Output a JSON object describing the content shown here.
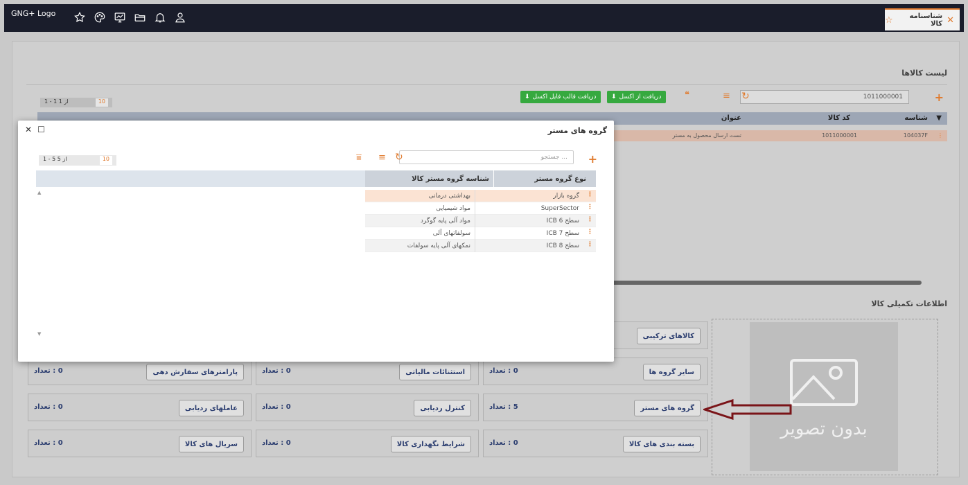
{
  "topbar": {
    "logo_text": "GNG+ Logo",
    "tab_label": "شناسنامه کالا"
  },
  "main": {
    "list_title": "لیست کالاها",
    "search_value": "1011000001",
    "btn_template": "دریافت قالب فایل اکسل",
    "btn_import": "دریافت از اکسل",
    "pager_range": "1 - 1 از 1",
    "pager_size": "10",
    "columns": [
      "شناسه",
      "کد کالا",
      "عنوان"
    ],
    "row": {
      "id": "104037F",
      "code": "1011000001",
      "title": "تست ارسال محصول به مستر"
    },
    "extra_title": "اطلاعات تکمیلی کالا"
  },
  "noimage_text": "بدون تصویر",
  "cells": {
    "combo": "کالاهای ترکیبی",
    "other_groups": "سایر گروه ها",
    "other_groups_count": "0 : تعداد",
    "tax": "استثنائات مالیاتی",
    "tax_count": "0 : تعداد",
    "order_params": "پارامترهای سفارش دهی",
    "order_params_count": "0 : تعداد",
    "master_groups": "گروه های مستر",
    "master_groups_count": "5 : تعداد",
    "tracking_control": "کنترل ردیابی",
    "tracking_control_count": "0 : تعداد",
    "tracking_factors": "عاملهای ردیابی",
    "tracking_factors_count": "0 : تعداد",
    "packaging": "بسته بندی های کالا",
    "packaging_count": "0 : تعداد",
    "storage": "شرایط نگهداری کالا",
    "storage_count": "0 : تعداد",
    "serials": "سریال های کالا",
    "serials_count": "0 : تعداد"
  },
  "modal": {
    "title": "گروه های مستر",
    "search_placeholder": "جستجو ...",
    "pager_range": "1 - 5 از 5",
    "pager_size": "10",
    "col_type": "نوع گروه مستر",
    "col_id": "شناسه گروه مستر کالا",
    "rows": [
      {
        "type": "گروه بازار",
        "id": "بهداشتی درمانی"
      },
      {
        "type": "SuperSector",
        "id": "مواد شیمیایی"
      },
      {
        "type": "ICB سطح 6",
        "id": "مواد آلی پایه گوگرد"
      },
      {
        "type": "ICB سطح 7",
        "id": "سولفاتهای آلی"
      },
      {
        "type": "ICB سطح 8",
        "id": "نمکهای آلی پایه سولفات"
      }
    ]
  },
  "colors": {
    "accent": "#e07a2d",
    "green": "#36a93f",
    "dark": "#1a1d2b",
    "arrow": "#7a1418"
  }
}
